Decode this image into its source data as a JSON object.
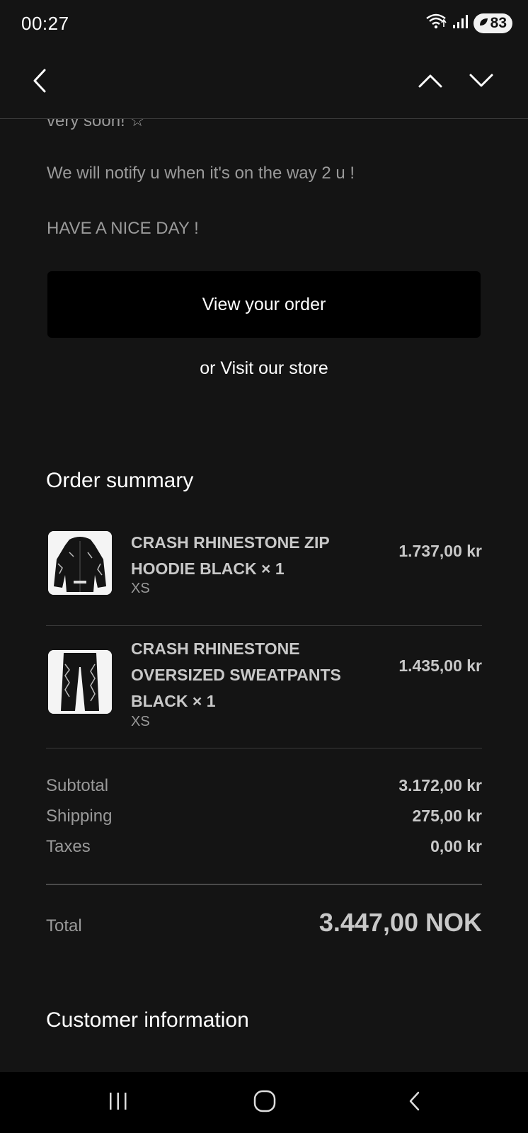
{
  "status_bar": {
    "time": "00:27",
    "battery": "83"
  },
  "message": {
    "partial_line": "very soon! ☆",
    "notify_line": "We will notify u when it's on the way 2 u !",
    "greeting": "HAVE A NICE DAY !"
  },
  "buttons": {
    "view_order": "View your order",
    "visit_store": "or Visit our store"
  },
  "order_summary": {
    "title": "Order summary",
    "items": [
      {
        "name": "CRASH RHINESTONE ZIP HOODIE BLACK × 1",
        "variant": "XS",
        "price": "1.737,00 kr"
      },
      {
        "name": "CRASH RHINESTONE OVERSIZED SWEATPANTS BLACK × 1",
        "variant": "XS",
        "price": "1.435,00 kr"
      }
    ],
    "subtotal_label": "Subtotal",
    "subtotal_value": "3.172,00 kr",
    "shipping_label": "Shipping",
    "shipping_value": "275,00 kr",
    "taxes_label": "Taxes",
    "taxes_value": "0,00 kr",
    "total_label": "Total",
    "total_value": "3.447,00 NOK"
  },
  "customer_information": {
    "title": "Customer information"
  },
  "icons": {
    "back": "chevron-left-icon",
    "prev": "chevron-up-icon",
    "next": "chevron-down-icon",
    "recents": "recents-icon",
    "home": "home-icon",
    "system_back": "system-back-icon"
  }
}
